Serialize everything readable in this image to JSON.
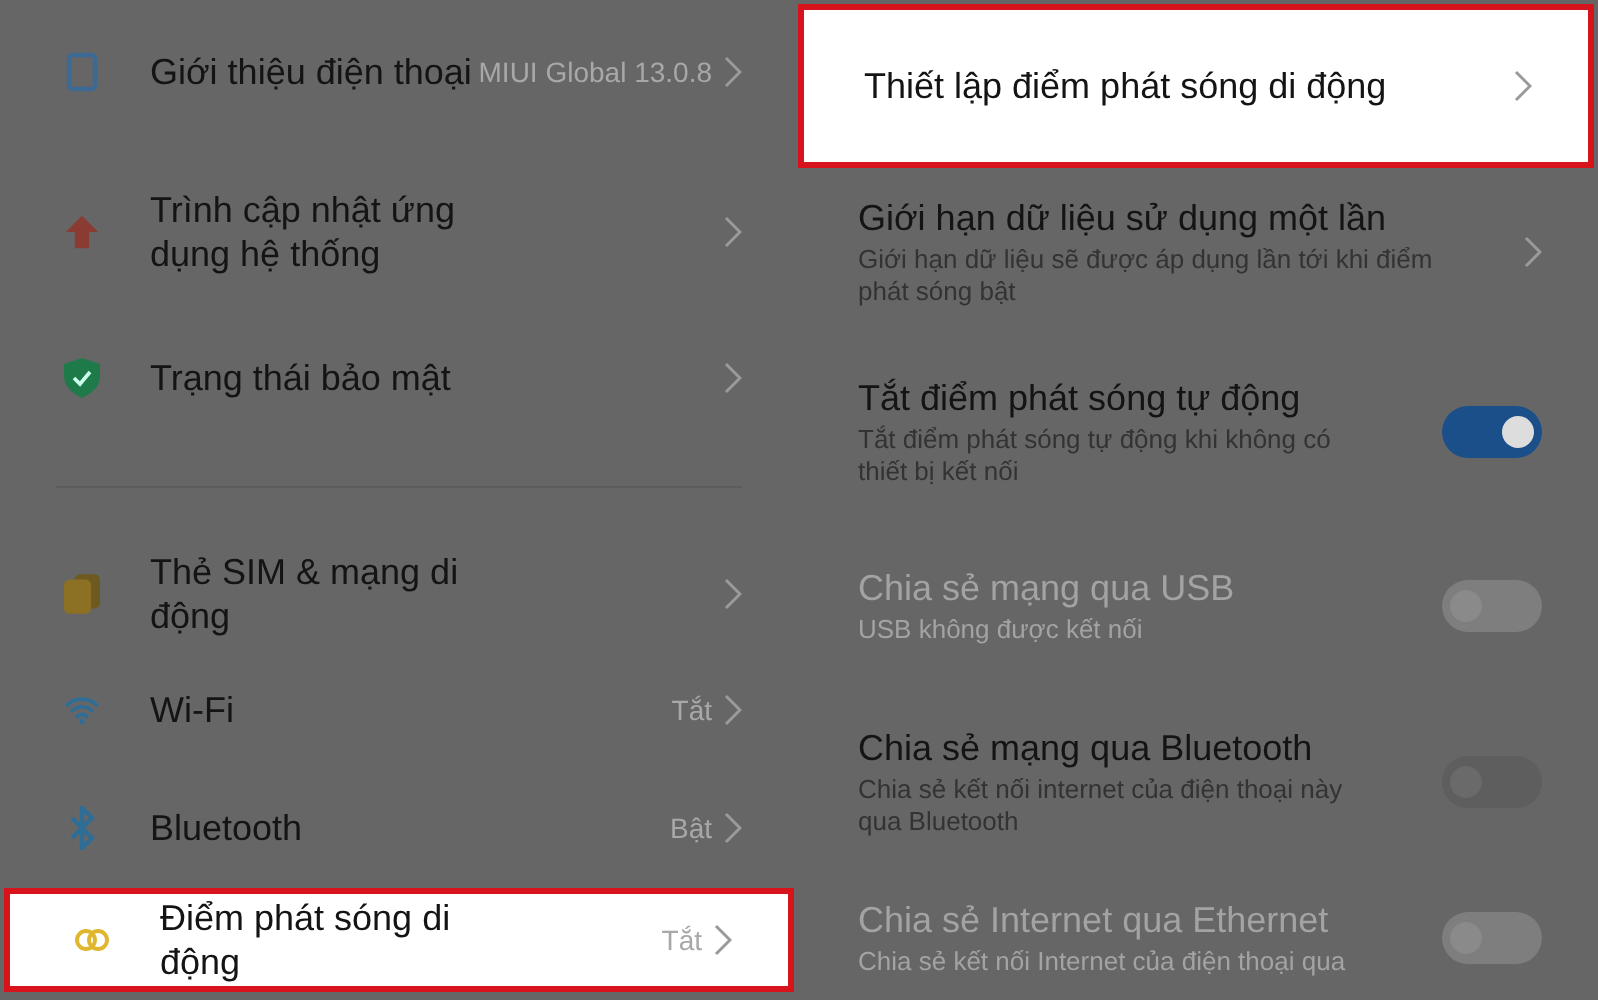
{
  "settings_list": {
    "items": [
      {
        "title": "Giới thiệu điện thoại",
        "value": "MIUI Global 13.0.8",
        "highlighted": false
      },
      {
        "title": "Trình cập nhật ứng dụng hệ thống",
        "highlighted": false
      },
      {
        "title": "Trạng thái bảo mật",
        "highlighted": false
      },
      {
        "title": "Thẻ SIM & mạng di động",
        "highlighted": false
      },
      {
        "title": "Wi-Fi",
        "value": "Tắt",
        "highlighted": false
      },
      {
        "title": "Bluetooth",
        "value": "Bật",
        "highlighted": false
      },
      {
        "title": "Điểm phát sóng di động",
        "value": "Tắt",
        "highlighted": true
      }
    ]
  },
  "hotspot_settings": {
    "items": [
      {
        "kind": "link",
        "title": "Thiết lập điểm phát sóng di động",
        "highlighted": true,
        "disabled": false
      },
      {
        "kind": "link",
        "title": "Giới hạn dữ liệu sử dụng một lần",
        "subtitle": "Giới hạn dữ liệu sẽ được áp dụng lần tới khi điểm phát sóng bật",
        "highlighted": false,
        "disabled": false
      },
      {
        "kind": "toggle",
        "title": "Tắt điểm phát sóng tự động",
        "subtitle": "Tắt điểm phát sóng tự động khi không có thiết bị kết nối",
        "on": true,
        "highlighted": false,
        "disabled": false
      },
      {
        "kind": "toggle",
        "title": "Chia sẻ mạng qua USB",
        "subtitle": "USB không được kết nối",
        "on": false,
        "highlighted": false,
        "disabled": true
      },
      {
        "kind": "toggle",
        "title": "Chia sẻ mạng qua Bluetooth",
        "subtitle": "Chia sẻ kết nối internet của điện thoại này qua Bluetooth",
        "on": false,
        "highlighted": false,
        "disabled": false
      },
      {
        "kind": "toggle",
        "title": "Chia sẻ Internet qua Ethernet",
        "subtitle": "Chia sẻ kết nối Internet của điện thoại qua",
        "on": false,
        "highlighted": false,
        "disabled": true
      }
    ]
  }
}
